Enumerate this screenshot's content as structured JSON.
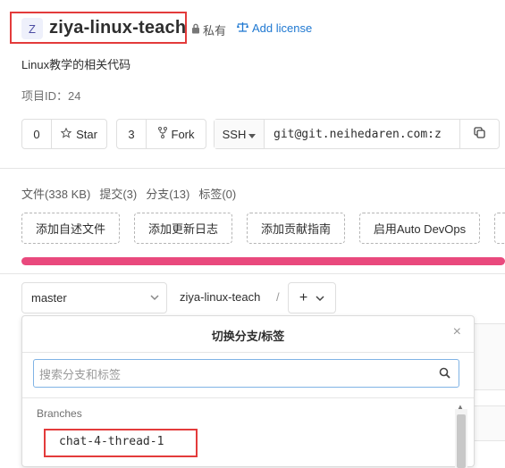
{
  "header": {
    "avatar_letter": "Z",
    "project_name": "ziya-linux-teach",
    "visibility": "私有",
    "add_license": "Add license"
  },
  "description": "Linux教学的相关代码",
  "project_id": "项目ID：24",
  "actions": {
    "star_count": "0",
    "star_label": "Star",
    "fork_count": "3",
    "fork_label": "Fork",
    "protocol": "SSH",
    "clone_url": "git@git.neihedaren.com:z"
  },
  "stats": {
    "files": "文件(338 KB)",
    "commits": "提交(3)",
    "branches": "分支(13)",
    "tags": "标签(0)"
  },
  "quick_actions": [
    "添加自述文件",
    "添加更新日志",
    "添加贡献指南",
    "启用Auto DevOps"
  ],
  "branch_bar": {
    "current_branch": "master",
    "path": "ziya-linux-teach",
    "slash": "/",
    "add": "+"
  },
  "dropdown": {
    "title": "切换分支/标签",
    "close": "×",
    "search_placeholder": "搜索分支和标签",
    "section_label": "Branches",
    "items": [
      "chat-4-thread-1"
    ]
  },
  "colors": {
    "accent": "#1f78d1",
    "progress": "#e9497d",
    "highlight": "#e33b3b"
  }
}
